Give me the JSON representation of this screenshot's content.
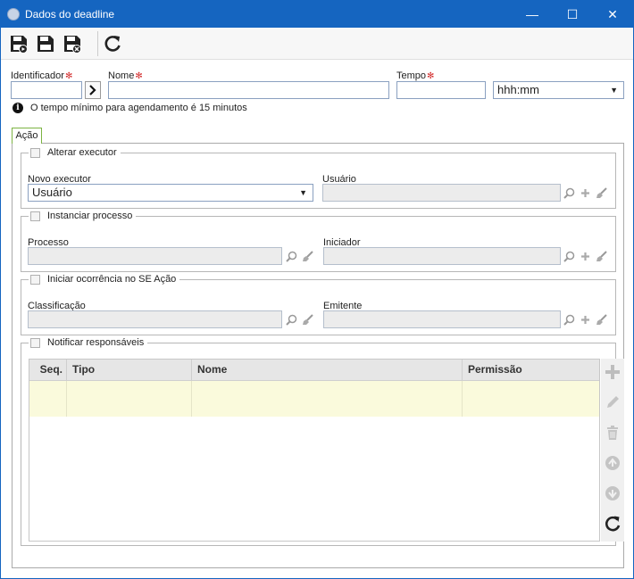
{
  "window": {
    "title": "Dados do deadline",
    "minimize": "—",
    "maximize": "☐",
    "close": "✕"
  },
  "form": {
    "identificador_label": "Identificador",
    "nome_label": "Nome",
    "tempo_label": "Tempo",
    "required_mark": "✻",
    "time_format": "hhh:mm",
    "info_text": "O tempo mínimo para agendamento é 15 minutos"
  },
  "tabs": [
    {
      "label": "Ação"
    }
  ],
  "alterar_executor": {
    "label": "Alterar executor",
    "novo_executor_label": "Novo executor",
    "novo_executor_value": "Usuário",
    "usuario_label": "Usuário"
  },
  "instanciar_processo": {
    "label": "Instanciar processo",
    "processo_label": "Processo",
    "iniciador_label": "Iniciador"
  },
  "iniciar_ocorrencia": {
    "label": "Iniciar ocorrência no SE Ação",
    "classificacao_label": "Classificação",
    "emitente_label": "Emitente"
  },
  "notificar": {
    "label": "Notificar responsáveis",
    "columns": [
      "Seq.",
      "Tipo",
      "Nome",
      "Permissão"
    ]
  }
}
